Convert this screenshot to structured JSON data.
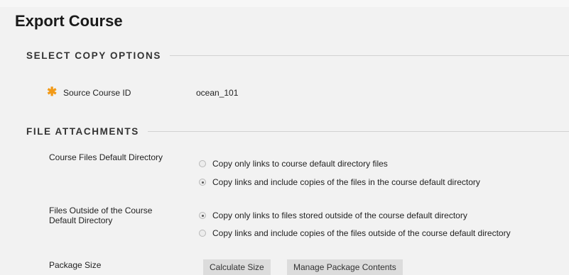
{
  "page": {
    "title": "Export Course"
  },
  "colors": {
    "required_star": "#f29a17",
    "background": "#f2f2f2",
    "button_bg": "#dcdcdc"
  },
  "sections": {
    "select_copy_options": {
      "heading": "SELECT COPY OPTIONS",
      "source_course": {
        "required_icon": "asterisk-icon",
        "label": "Source Course ID",
        "value": "ocean_101"
      }
    },
    "file_attachments": {
      "heading": "FILE ATTACHMENTS",
      "default_directory": {
        "label": "Course Files Default Directory",
        "options": [
          {
            "label": "Copy only links to course default directory files",
            "selected": false
          },
          {
            "label": "Copy links and include copies of the files in the course default directory",
            "selected": true
          }
        ]
      },
      "outside_directory": {
        "label_line1": "Files Outside of the Course",
        "label_line2": "Default Directory",
        "options": [
          {
            "label": "Copy only links to files stored outside of the course default directory",
            "selected": true
          },
          {
            "label": "Copy links and include copies of the files outside of the course default directory",
            "selected": false
          }
        ]
      },
      "package_size": {
        "label": "Package Size",
        "calculate_button": "Calculate Size",
        "manage_button": "Manage Package Contents"
      }
    }
  }
}
